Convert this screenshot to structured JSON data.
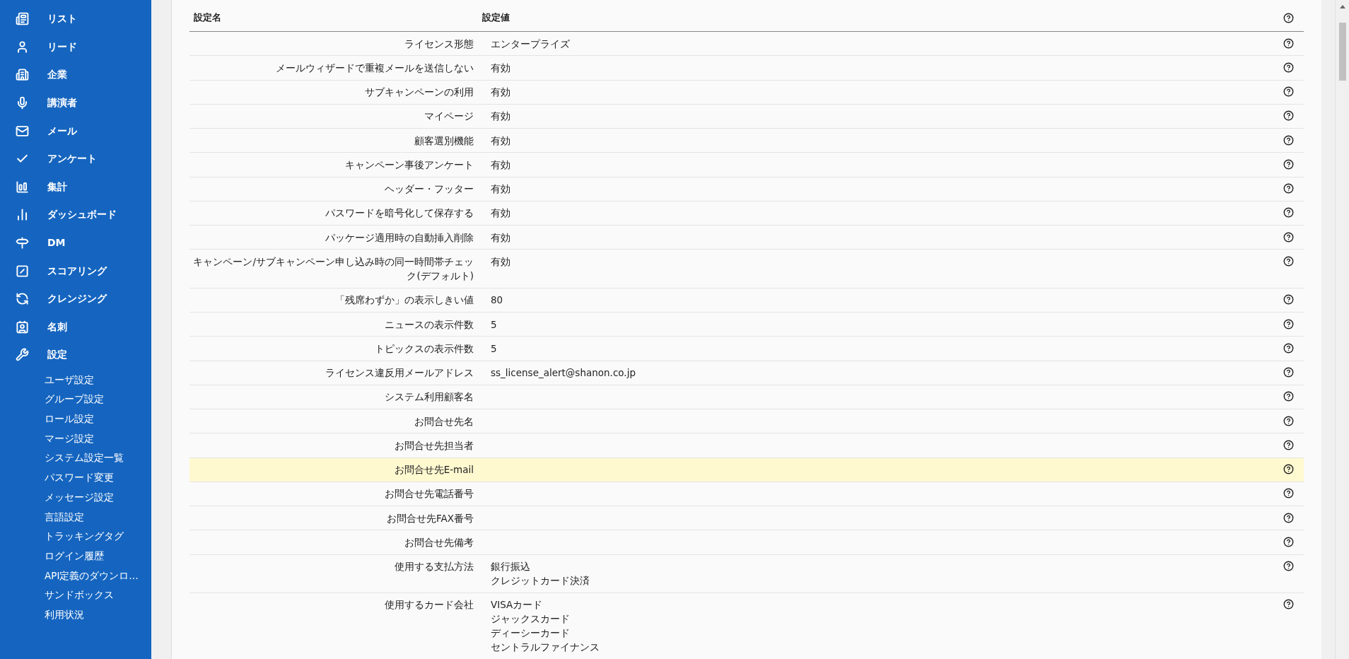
{
  "sidebar": {
    "items": [
      {
        "label": "リスト"
      },
      {
        "label": "リード"
      },
      {
        "label": "企業"
      },
      {
        "label": "講演者"
      },
      {
        "label": "メール"
      },
      {
        "label": "アンケート"
      },
      {
        "label": "集計"
      },
      {
        "label": "ダッシュボード"
      },
      {
        "label": "DM"
      },
      {
        "label": "スコアリング"
      },
      {
        "label": "クレンジング"
      },
      {
        "label": "名刺"
      },
      {
        "label": "設定",
        "children": [
          "ユーザ設定",
          "グループ設定",
          "ロール設定",
          "マージ設定",
          "システム設定一覧",
          "パスワード変更",
          "メッセージ設定",
          "言語設定",
          "トラッキングタグ",
          "ログイン履歴",
          "API定義のダウンロ…",
          "サンドボックス",
          "利用状況"
        ]
      }
    ]
  },
  "table": {
    "columns": [
      "設定名",
      "設定値"
    ],
    "rows": [
      {
        "name": "ライセンス形態",
        "values": [
          "エンタープライズ"
        ],
        "selected": false
      },
      {
        "name": "メールウィザードで重複メールを送信しない",
        "values": [
          "有効"
        ],
        "selected": false
      },
      {
        "name": "サブキャンペーンの利用",
        "values": [
          "有効"
        ],
        "selected": false
      },
      {
        "name": "マイページ",
        "values": [
          "有効"
        ],
        "selected": false
      },
      {
        "name": "顧客選別機能",
        "values": [
          "有効"
        ],
        "selected": false
      },
      {
        "name": "キャンペーン事後アンケート",
        "values": [
          "有効"
        ],
        "selected": false
      },
      {
        "name": "ヘッダー・フッター",
        "values": [
          "有効"
        ],
        "selected": false
      },
      {
        "name": "パスワードを暗号化して保存する",
        "values": [
          "有効"
        ],
        "selected": false
      },
      {
        "name": "パッケージ適用時の自動挿入削除",
        "values": [
          "有効"
        ],
        "selected": false
      },
      {
        "name": "キャンペーン/サブキャンペーン申し込み時の同一時間帯チェック(デフォルト)",
        "values": [
          "有効"
        ],
        "selected": false
      },
      {
        "name": "「残席わずか」の表示しきい値",
        "values": [
          "80"
        ],
        "selected": false
      },
      {
        "name": "ニュースの表示件数",
        "values": [
          "5"
        ],
        "selected": false
      },
      {
        "name": "トピックスの表示件数",
        "values": [
          "5"
        ],
        "selected": false
      },
      {
        "name": "ライセンス違反用メールアドレス",
        "values": [
          "ss_license_alert@shanon.co.jp"
        ],
        "selected": false
      },
      {
        "name": "システム利用顧客名",
        "values": [],
        "selected": false
      },
      {
        "name": "お問合せ先名",
        "values": [],
        "selected": false
      },
      {
        "name": "お問合せ先担当者",
        "values": [],
        "selected": false
      },
      {
        "name": "お問合せ先E-mail",
        "values": [],
        "selected": true
      },
      {
        "name": "お問合せ先電話番号",
        "values": [],
        "selected": false
      },
      {
        "name": "お問合せ先FAX番号",
        "values": [],
        "selected": false
      },
      {
        "name": "お問合せ先備考",
        "values": [],
        "selected": false
      },
      {
        "name": "使用する支払方法",
        "values": [
          "銀行振込",
          "クレジットカード決済"
        ],
        "selected": false
      },
      {
        "name": "使用するカード会社",
        "values": [
          "VISAカード",
          "ジャックスカード",
          "ディーシーカード",
          "セントラルファイナンス"
        ],
        "selected": false
      }
    ]
  }
}
